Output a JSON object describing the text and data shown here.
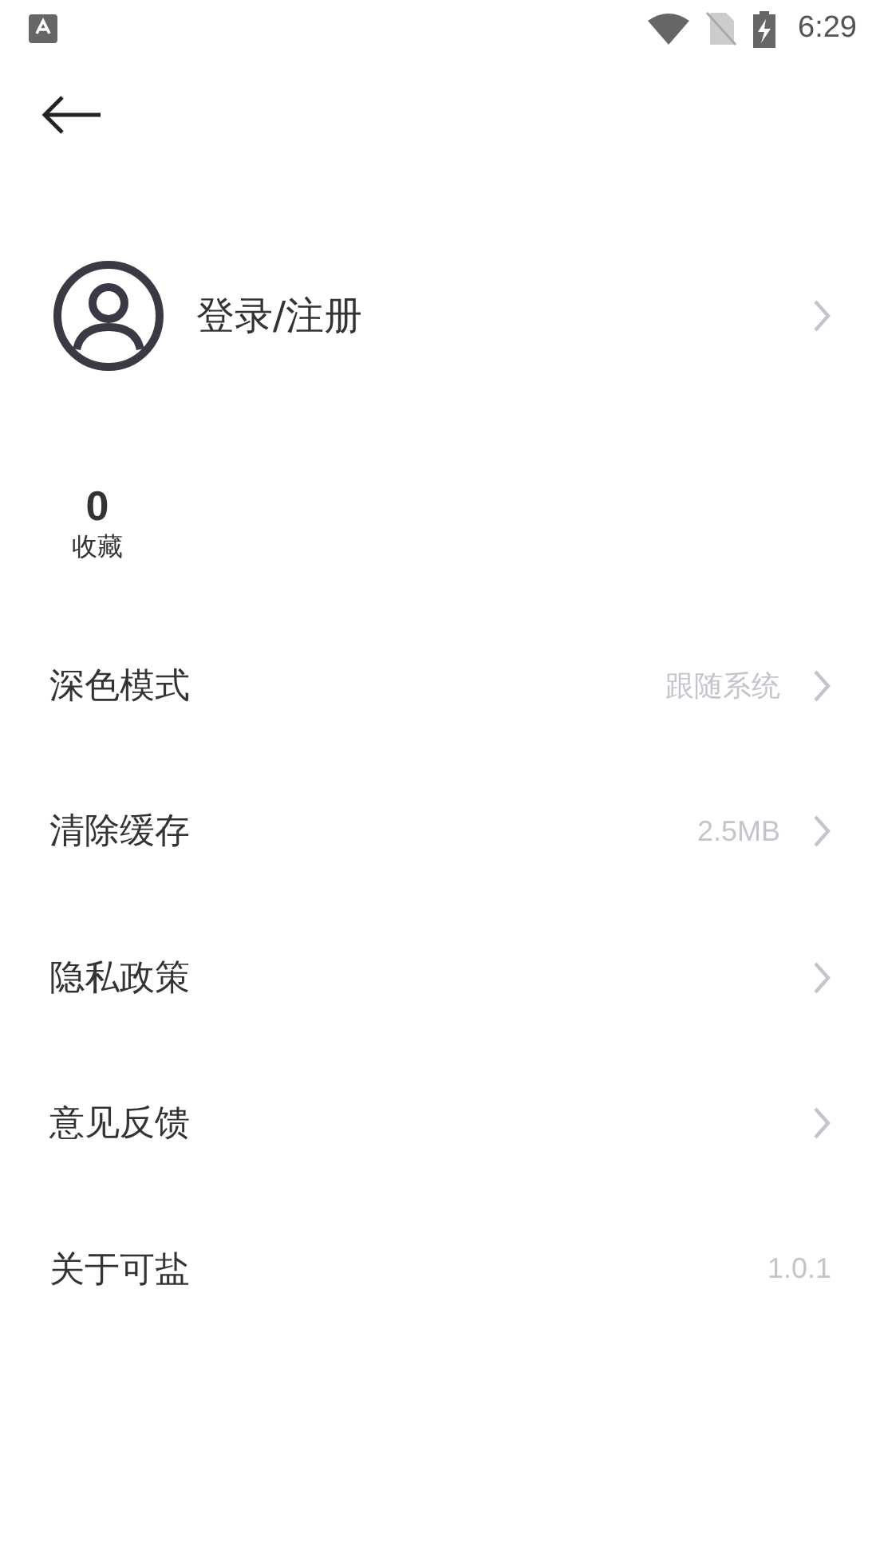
{
  "status_bar": {
    "time": "6:29"
  },
  "profile": {
    "label": "登录/注册"
  },
  "stats": [
    {
      "value": "0",
      "label": "收藏"
    }
  ],
  "settings": [
    {
      "label": "深色模式",
      "value": "跟随系统",
      "chevron": true
    },
    {
      "label": "清除缓存",
      "value": "2.5MB",
      "chevron": true
    },
    {
      "label": "隐私政策",
      "chevron": true
    },
    {
      "label": "意见反馈",
      "chevron": true
    },
    {
      "label": "关于可盐",
      "value": "1.0.1",
      "chevron": false
    }
  ]
}
